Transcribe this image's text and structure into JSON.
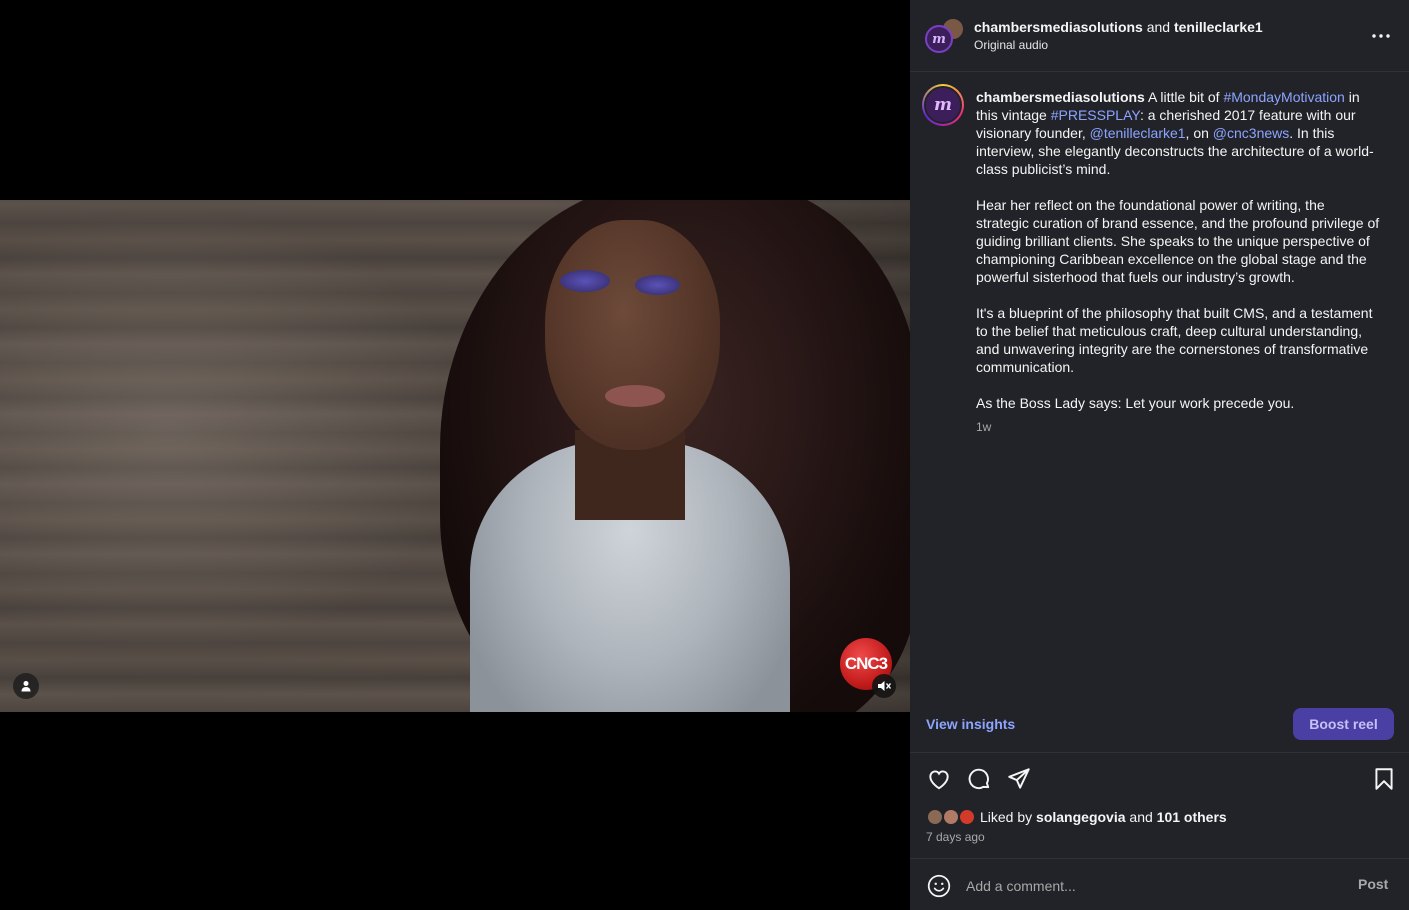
{
  "video": {
    "watermark": "CNC3",
    "person_icon": "person-icon",
    "mute_icon": "speaker-muted-icon"
  },
  "header": {
    "author": "chambersmediasolutions",
    "joiner": "and",
    "collaborator": "tenilleclarke1",
    "audio": "Original audio",
    "more_icon": "more-horizontal-icon",
    "avatar_letter": "m"
  },
  "caption": {
    "username": "chambersmediasolutions",
    "p1": [
      {
        "t": " A little bit of ",
        "k": "text"
      },
      {
        "t": "#MondayMotivation",
        "k": "tag"
      },
      {
        "t": " in this vintage ",
        "k": "text"
      },
      {
        "t": "#PRESSPLAY",
        "k": "tag"
      },
      {
        "t": ": a cherished 2017 feature with our visionary founder, ",
        "k": "text"
      },
      {
        "t": "@tenilleclarke1",
        "k": "tag"
      },
      {
        "t": ", on ",
        "k": "text"
      },
      {
        "t": "@cnc3news",
        "k": "tag"
      },
      {
        "t": ". In this interview, she elegantly deconstructs the architecture of a world-class publicist’s mind.",
        "k": "text"
      }
    ],
    "p2": "Hear her reflect on the foundational power of writing, the strategic curation of brand essence, and the profound privilege of guiding brilliant clients. She speaks to the unique perspective of championing Caribbean excellence on the global stage and the powerful sisterhood that fuels our industry’s growth.",
    "p3": "It's a blueprint of the philosophy that built CMS, and a testament to the belief that meticulous craft, deep cultural understanding, and unwavering integrity are the cornerstones of transformative communication.",
    "p4": "As the Boss Lady says: Let your work precede you.",
    "time": "1w"
  },
  "actions": {
    "view_insights": "View insights",
    "boost": "Boost reel",
    "icons": [
      "heart-icon",
      "comment-icon",
      "share-icon",
      "bookmark-icon"
    ]
  },
  "likes": {
    "prefix": "Liked by",
    "user": "solangegovia",
    "joiner": "and",
    "others": "101 others",
    "ago": "7 days ago"
  },
  "comment": {
    "placeholder": "Add a comment...",
    "post": "Post",
    "emoji_icon": "emoji-icon"
  },
  "colors": {
    "panel_bg": "#212328",
    "link": "#8da4ff",
    "boost_bg": "#4a3fa3"
  }
}
